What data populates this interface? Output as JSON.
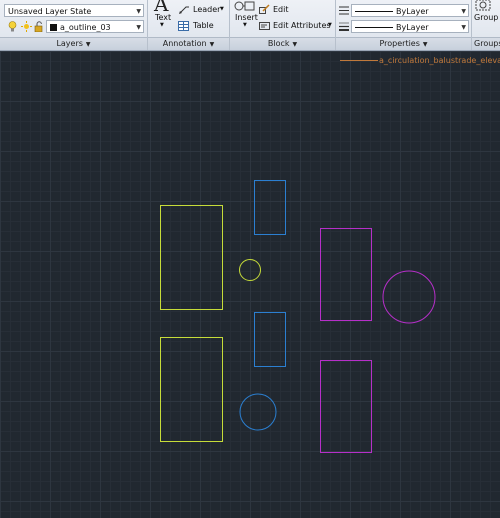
{
  "ribbon": {
    "layers": {
      "layer_state": "Unsaved Layer State",
      "current_layer": "a_outline_03",
      "title": "Layers"
    },
    "annotation": {
      "text_label": "Text",
      "leader_label": "Leader",
      "table_label": "Table",
      "title": "Annotation"
    },
    "block": {
      "insert_label": "Insert",
      "edit_label": "Edit",
      "edit_attributes_label": "Edit Attributes",
      "title": "Block"
    },
    "properties": {
      "linetype": "ByLayer",
      "lineweight": "ByLayer",
      "title": "Properties"
    },
    "groups": {
      "group_label": "Group",
      "title": "Groups"
    }
  },
  "canvas": {
    "view_label": "a_circulation_balustrade_elevation"
  },
  "colors": {
    "yellow_green": "#c6dc39",
    "blue": "#2b7fd1",
    "magenta": "#b62fc9",
    "label_orange": "#c0793b"
  }
}
